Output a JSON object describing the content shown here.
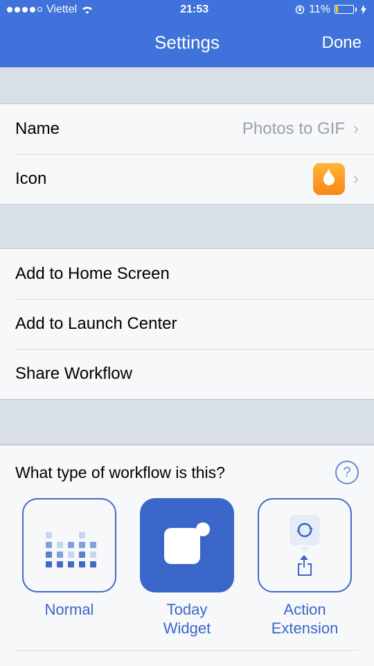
{
  "status": {
    "carrier": "Viettel",
    "time": "21:53",
    "battery_pct": "11%"
  },
  "nav": {
    "title": "Settings",
    "done": "Done"
  },
  "rows": {
    "name_label": "Name",
    "name_value": "Photos to GIF",
    "icon_label": "Icon",
    "home": "Add to Home Screen",
    "launch": "Add to Launch Center",
    "share": "Share Workflow"
  },
  "type": {
    "question": "What type of workflow is this?",
    "normal": "Normal",
    "today": "Today Widget",
    "action": "Action Extension",
    "selected": "today"
  }
}
